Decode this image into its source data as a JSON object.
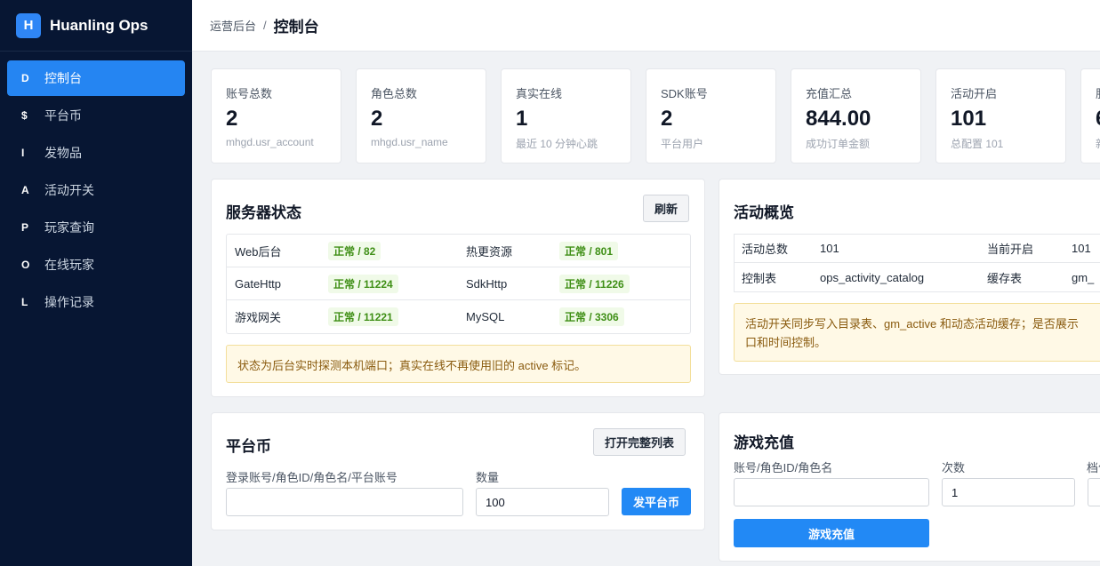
{
  "brand": {
    "logo_letter": "H",
    "name": "Huanling Ops"
  },
  "sidebar": {
    "items": [
      {
        "key": "D",
        "label": "控制台",
        "active": true
      },
      {
        "key": "$",
        "label": "平台币"
      },
      {
        "key": "I",
        "label": "发物品"
      },
      {
        "key": "A",
        "label": "活动开关"
      },
      {
        "key": "P",
        "label": "玩家查询"
      },
      {
        "key": "O",
        "label": "在线玩家"
      },
      {
        "key": "L",
        "label": "操作记录"
      }
    ]
  },
  "header": {
    "parent": "运营后台",
    "separator": "/",
    "current": "控制台"
  },
  "stats": [
    {
      "label": "账号总数",
      "value": "2",
      "sub": "mhgd.usr_account"
    },
    {
      "label": "角色总数",
      "value": "2",
      "sub": "mhgd.usr_name"
    },
    {
      "label": "真实在线",
      "value": "1",
      "sub": "最近 10 分钟心跳"
    },
    {
      "label": "SDK账号",
      "value": "2",
      "sub": "平台用户"
    },
    {
      "label": "充值汇总",
      "value": "844.00",
      "sub": "成功订单金额"
    },
    {
      "label": "活动开启",
      "value": "101",
      "sub": "总配置 101"
    },
    {
      "label": "服",
      "value": "6",
      "sub": "新"
    }
  ],
  "server_status": {
    "title": "服务器状态",
    "refresh_label": "刷新",
    "rows": [
      [
        {
          "name": "Web后台",
          "status": "正常 / 82"
        },
        {
          "name": "热更资源",
          "status": "正常 / 801"
        }
      ],
      [
        {
          "name": "GateHttp",
          "status": "正常 / 11224"
        },
        {
          "name": "SdkHttp",
          "status": "正常 / 11226"
        }
      ],
      [
        {
          "name": "游戏网关",
          "status": "正常 / 11221"
        },
        {
          "name": "MySQL",
          "status": "正常 / 3306"
        }
      ]
    ],
    "notice": "状态为后台实时探测本机端口；真实在线不再使用旧的 active 标记。"
  },
  "activity": {
    "title": "活动概览",
    "rows": [
      {
        "k1": "活动总数",
        "v1": "101",
        "k2": "当前开启",
        "v2": "101"
      },
      {
        "k1": "控制表",
        "v1": "ops_activity_catalog",
        "k2": "缓存表",
        "v2": "gm_"
      }
    ],
    "notice_line1": "活动开关同步写入目录表、gm_active 和动态活动缓存；是否展示",
    "notice_line2": "口和时间控制。"
  },
  "platform_coin": {
    "title": "平台币",
    "open_list_label": "打开完整列表",
    "account_label": "登录账号/角色ID/角色名/平台账号",
    "account_value": "",
    "amount_label": "数量",
    "amount_value": "100",
    "submit_label": "发平台币"
  },
  "game_recharge": {
    "title": "游戏充值",
    "account_label": "账号/角色ID/角色名",
    "account_value": "",
    "count_label": "次数",
    "count_value": "1",
    "tier_label": "档位",
    "submit_label": "游戏充值"
  }
}
